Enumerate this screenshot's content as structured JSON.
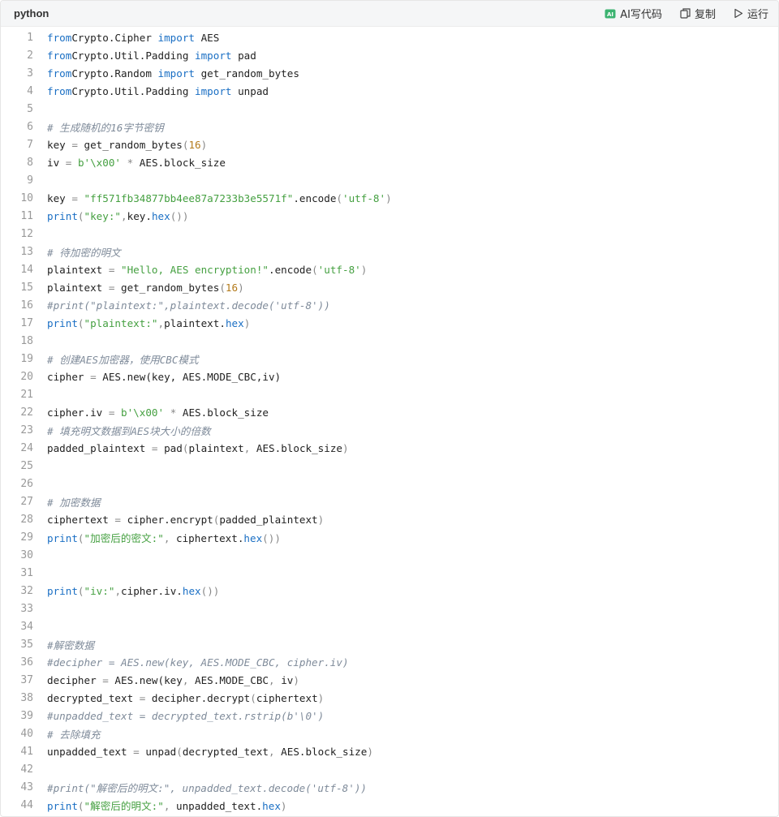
{
  "header": {
    "language": "python",
    "ai_label": "AI写代码",
    "copy_label": "复制",
    "run_label": "运行"
  },
  "colors": {
    "keyword": "#1a6fc4",
    "string": "#45a041",
    "number": "#b37a1a",
    "comment": "#7f8b9a"
  },
  "lines": [
    {
      "n": "1",
      "t": [
        [
          "k",
          "from"
        ],
        [
          "",
          "Crypto.Cipher "
        ],
        [
          "k",
          "import"
        ],
        [
          "",
          " AES"
        ]
      ]
    },
    {
      "n": "2",
      "t": [
        [
          "k",
          "from"
        ],
        [
          "",
          "Crypto.Util.Padding "
        ],
        [
          "k",
          "import"
        ],
        [
          "",
          " pad"
        ]
      ]
    },
    {
      "n": "3",
      "t": [
        [
          "k",
          "from"
        ],
        [
          "",
          "Crypto.Random "
        ],
        [
          "k",
          "import"
        ],
        [
          "",
          " get_random_bytes"
        ]
      ]
    },
    {
      "n": "4",
      "t": [
        [
          "k",
          "from"
        ],
        [
          "",
          "Crypto.Util.Padding "
        ],
        [
          "k",
          "import"
        ],
        [
          "",
          " unpad"
        ]
      ]
    },
    {
      "n": "5",
      "t": []
    },
    {
      "n": "6",
      "t": [
        [
          "c",
          "# 生成随机的16字节密钥"
        ]
      ]
    },
    {
      "n": "7",
      "t": [
        [
          "",
          "key "
        ],
        [
          "p",
          "="
        ],
        [
          "",
          " get_random_bytes"
        ],
        [
          "p",
          "("
        ],
        [
          "n",
          "16"
        ],
        [
          "p",
          ")"
        ]
      ]
    },
    {
      "n": "8",
      "t": [
        [
          "",
          "iv "
        ],
        [
          "p",
          "="
        ],
        [
          "",
          " "
        ],
        [
          "s",
          "b'\\x00'"
        ],
        [
          "",
          " "
        ],
        [
          "p",
          "*"
        ],
        [
          "",
          " AES.block_size"
        ]
      ]
    },
    {
      "n": "9",
      "t": []
    },
    {
      "n": "10",
      "t": [
        [
          "",
          "key "
        ],
        [
          "p",
          "="
        ],
        [
          "",
          " "
        ],
        [
          "s",
          "\"ff571fb34877bb4ee87a7233b3e5571f\""
        ],
        [
          "",
          ".encode"
        ],
        [
          "p",
          "("
        ],
        [
          "s",
          "'utf-8'"
        ],
        [
          "p",
          ")"
        ]
      ]
    },
    {
      "n": "11",
      "t": [
        [
          "k",
          "print"
        ],
        [
          "p",
          "("
        ],
        [
          "s",
          "\"key:\""
        ],
        [
          "p",
          ","
        ],
        [
          "",
          "key."
        ],
        [
          "k",
          "hex"
        ],
        [
          "p",
          "())"
        ]
      ]
    },
    {
      "n": "12",
      "t": []
    },
    {
      "n": "13",
      "t": [
        [
          "c",
          "# 待加密的明文"
        ]
      ]
    },
    {
      "n": "14",
      "t": [
        [
          "",
          "plaintext "
        ],
        [
          "p",
          "="
        ],
        [
          "",
          " "
        ],
        [
          "s",
          "\"Hello, AES encryption!\""
        ],
        [
          "",
          ".encode"
        ],
        [
          "p",
          "("
        ],
        [
          "s",
          "'utf-8'"
        ],
        [
          "p",
          ")"
        ]
      ]
    },
    {
      "n": "15",
      "t": [
        [
          "",
          "plaintext "
        ],
        [
          "p",
          "="
        ],
        [
          "",
          " get_random_bytes"
        ],
        [
          "p",
          "("
        ],
        [
          "n",
          "16"
        ],
        [
          "p",
          ")"
        ]
      ]
    },
    {
      "n": "16",
      "t": [
        [
          "c",
          "#print(\"plaintext:\",plaintext.decode('utf-8'))"
        ]
      ]
    },
    {
      "n": "17",
      "t": [
        [
          "k",
          "print"
        ],
        [
          "p",
          "("
        ],
        [
          "s",
          "\"plaintext:\""
        ],
        [
          "p",
          ","
        ],
        [
          "",
          "plaintext."
        ],
        [
          "k",
          "hex"
        ],
        [
          "p",
          ")"
        ]
      ]
    },
    {
      "n": "18",
      "t": []
    },
    {
      "n": "19",
      "t": [
        [
          "c",
          "# 创建AES加密器，使用CBC模式"
        ]
      ]
    },
    {
      "n": "20",
      "t": [
        [
          "",
          "cipher "
        ],
        [
          "p",
          "="
        ],
        [
          "",
          " AES.new(key, AES.MODE_CBC,iv)"
        ]
      ]
    },
    {
      "n": "21",
      "t": []
    },
    {
      "n": "22",
      "t": [
        [
          "",
          "cipher.iv "
        ],
        [
          "p",
          "="
        ],
        [
          "",
          " "
        ],
        [
          "s",
          "b'\\x00'"
        ],
        [
          "",
          " "
        ],
        [
          "p",
          "*"
        ],
        [
          "",
          " AES.block_size"
        ]
      ]
    },
    {
      "n": "23",
      "t": [
        [
          "c",
          "# 填充明文数据到AES块大小的倍数"
        ]
      ]
    },
    {
      "n": "24",
      "t": [
        [
          "",
          "padded_plaintext "
        ],
        [
          "p",
          "="
        ],
        [
          "",
          " pad"
        ],
        [
          "p",
          "("
        ],
        [
          "",
          "plaintext"
        ],
        [
          "p",
          ","
        ],
        [
          "",
          " AES.block_size"
        ],
        [
          "p",
          ")"
        ]
      ]
    },
    {
      "n": "25",
      "t": []
    },
    {
      "n": "26",
      "t": []
    },
    {
      "n": "27",
      "t": [
        [
          "c",
          "# 加密数据"
        ]
      ]
    },
    {
      "n": "28",
      "t": [
        [
          "",
          "ciphertext "
        ],
        [
          "p",
          "="
        ],
        [
          "",
          " cipher.encrypt"
        ],
        [
          "p",
          "("
        ],
        [
          "",
          "padded_plaintext"
        ],
        [
          "p",
          ")"
        ]
      ]
    },
    {
      "n": "29",
      "t": [
        [
          "k",
          "print"
        ],
        [
          "p",
          "("
        ],
        [
          "s",
          "\"加密后的密文:\""
        ],
        [
          "p",
          ","
        ],
        [
          "",
          " ciphertext."
        ],
        [
          "k",
          "hex"
        ],
        [
          "p",
          "())"
        ]
      ]
    },
    {
      "n": "30",
      "t": []
    },
    {
      "n": "31",
      "t": []
    },
    {
      "n": "32",
      "t": [
        [
          "k",
          "print"
        ],
        [
          "p",
          "("
        ],
        [
          "s",
          "\"iv:\""
        ],
        [
          "p",
          ","
        ],
        [
          "",
          "cipher.iv."
        ],
        [
          "k",
          "hex"
        ],
        [
          "p",
          "())"
        ]
      ]
    },
    {
      "n": "33",
      "t": []
    },
    {
      "n": "34",
      "t": []
    },
    {
      "n": "35",
      "t": [
        [
          "c",
          "#解密数据"
        ]
      ]
    },
    {
      "n": "36",
      "t": [
        [
          "c",
          "#decipher = AES.new(key, AES.MODE_CBC, cipher.iv)"
        ]
      ]
    },
    {
      "n": "37",
      "t": [
        [
          "",
          "decipher "
        ],
        [
          "p",
          "="
        ],
        [
          "",
          " AES.new(key"
        ],
        [
          "p",
          ","
        ],
        [
          "",
          " AES.MODE_CBC"
        ],
        [
          "p",
          ","
        ],
        [
          "",
          " iv"
        ],
        [
          "p",
          ")"
        ]
      ]
    },
    {
      "n": "38",
      "t": [
        [
          "",
          "decrypted_text "
        ],
        [
          "p",
          "="
        ],
        [
          "",
          " decipher.decrypt"
        ],
        [
          "p",
          "("
        ],
        [
          "",
          "ciphertext"
        ],
        [
          "p",
          ")"
        ]
      ]
    },
    {
      "n": "39",
      "t": [
        [
          "c",
          "#unpadded_text = decrypted_text.rstrip(b'\\0')"
        ]
      ]
    },
    {
      "n": "40",
      "t": [
        [
          "c",
          "# 去除填充"
        ]
      ]
    },
    {
      "n": "41",
      "t": [
        [
          "",
          "unpadded_text "
        ],
        [
          "p",
          "="
        ],
        [
          "",
          " unpad"
        ],
        [
          "p",
          "("
        ],
        [
          "",
          "decrypted_text"
        ],
        [
          "p",
          ","
        ],
        [
          "",
          " AES.block_size"
        ],
        [
          "p",
          ")"
        ]
      ]
    },
    {
      "n": "42",
      "t": []
    },
    {
      "n": "43",
      "t": [
        [
          "c",
          "#print(\"解密后的明文:\", unpadded_text.decode('utf-8'))"
        ]
      ]
    },
    {
      "n": "44",
      "t": [
        [
          "k",
          "print"
        ],
        [
          "p",
          "("
        ],
        [
          "s",
          "\"解密后的明文:\""
        ],
        [
          "p",
          ","
        ],
        [
          "",
          " unpadded_text."
        ],
        [
          "k",
          "hex"
        ],
        [
          "p",
          ")"
        ]
      ]
    }
  ]
}
